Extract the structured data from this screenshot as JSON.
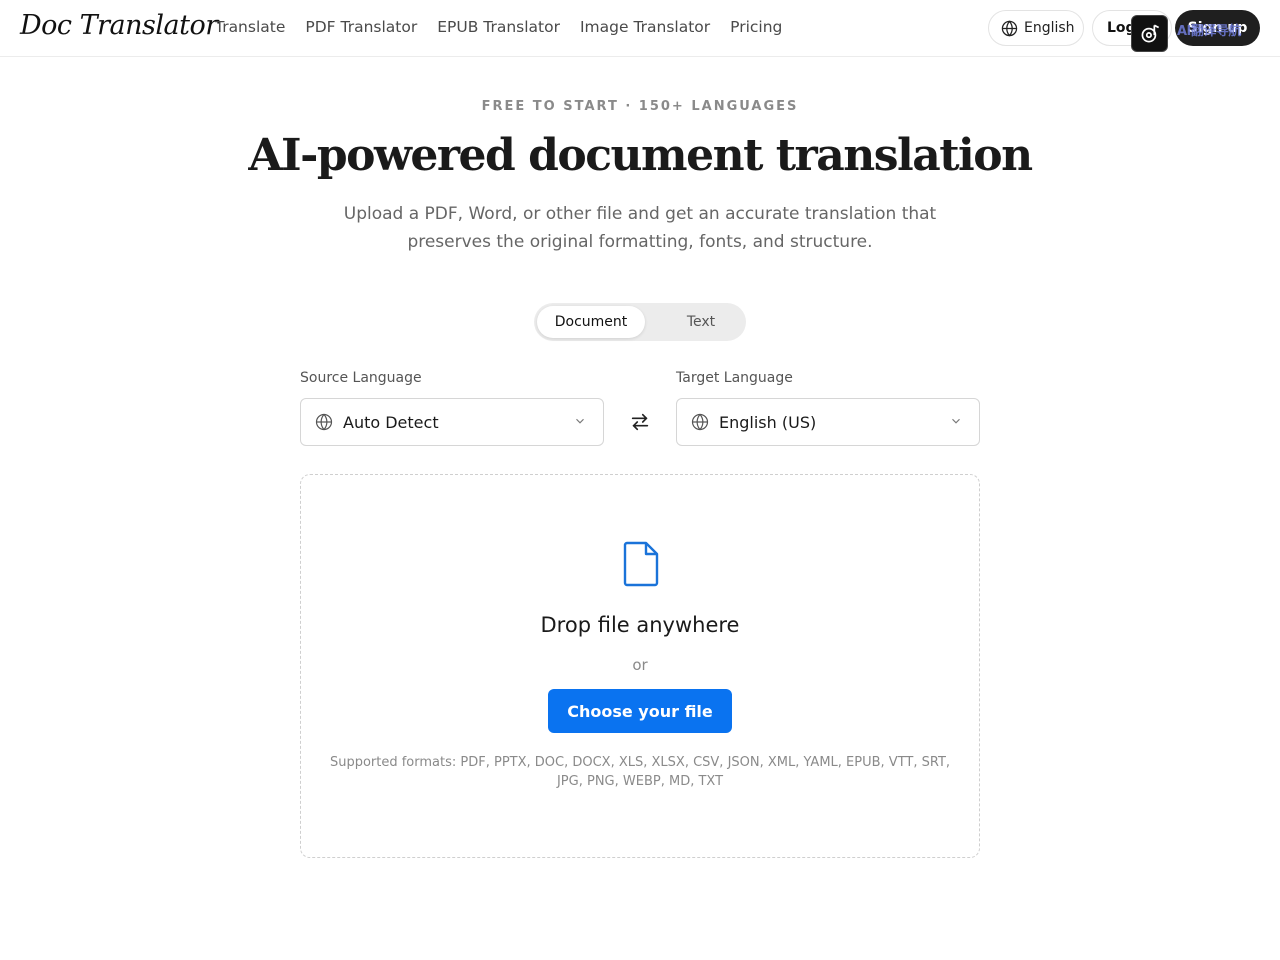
{
  "header": {
    "logo": "Doc Translator",
    "nav": [
      "Translate",
      "PDF Translator",
      "EPUB Translator",
      "Image Translator",
      "Pricing"
    ],
    "language_label": "English",
    "login_label": "Log",
    "signup_label": "Sign up",
    "extension_overlay": "AI翻译导航"
  },
  "hero": {
    "eyebrow": "FREE TO START · 150+ LANGUAGES",
    "headline": "AI-powered document translation",
    "subhead": "Upload a PDF, Word, or other file and get an accurate translation that preserves the original formatting, fonts, and structure."
  },
  "mode_toggle": {
    "options": [
      "Document",
      "Text"
    ],
    "selected": "Document"
  },
  "languages": {
    "source_label": "Source Language",
    "source_value": "Auto Detect",
    "target_label": "Target Language",
    "target_value": "English (US)"
  },
  "dropzone": {
    "title": "Drop file anywhere",
    "or": "or",
    "button": "Choose your file",
    "formats": "Supported formats: PDF, PPTX, DOC, DOCX, XLS, XLSX, CSV, JSON, XML, YAML, EPUB, VTT, SRT, JPG, PNG, WEBP, MD, TXT"
  },
  "colors": {
    "primary": "#0a73f0",
    "dark_button": "#1f1f1f",
    "muted_text": "#8a8a8a"
  }
}
